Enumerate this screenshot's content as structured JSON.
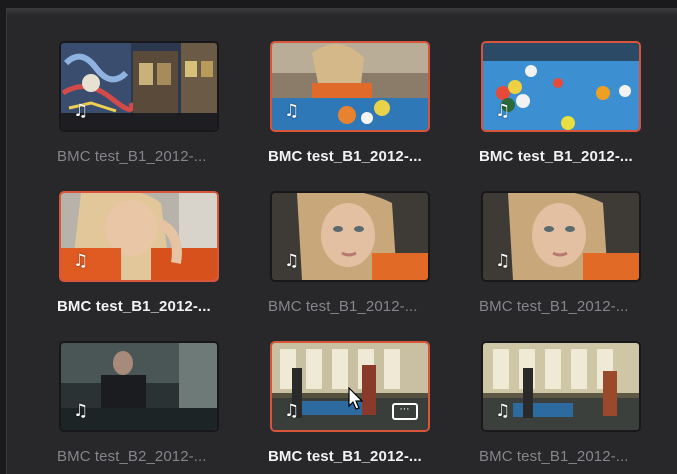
{
  "clips": [
    {
      "name": "BMC test_B1_2012-...",
      "scene": "graffiti",
      "selected": false,
      "has_audio": true
    },
    {
      "name": "BMC test_B1_2012-...",
      "scene": "pool-girl",
      "selected": true,
      "has_audio": true
    },
    {
      "name": "BMC test_B1_2012-...",
      "scene": "pool-table",
      "selected": true,
      "has_audio": true
    },
    {
      "name": "BMC test_B1_2012-...",
      "scene": "woman-hand",
      "selected": true,
      "has_audio": true
    },
    {
      "name": "BMC test_B1_2012-...",
      "scene": "woman-face",
      "selected": false,
      "has_audio": true
    },
    {
      "name": "BMC test_B1_2012-...",
      "scene": "woman-face",
      "selected": false,
      "has_audio": true
    },
    {
      "name": "BMC test_B2_2012-...",
      "scene": "man-room",
      "selected": false,
      "has_audio": true
    },
    {
      "name": "BMC test_B1_2012-...",
      "scene": "pool-hall",
      "selected": true,
      "has_audio": true,
      "hover": true,
      "more": "⋯"
    },
    {
      "name": "BMC test_B1_2012-...",
      "scene": "pool-hall2",
      "selected": false,
      "has_audio": true
    }
  ],
  "icons": {
    "audio": "music-note-icon",
    "more": "more-options-icon",
    "cursor": "mouse-pointer-icon"
  },
  "audio_glyph": "♫",
  "colors": {
    "selected_border": "#d8553c",
    "panel": "#28282b",
    "dim_text": "#85858a",
    "bright_text": "#f2f2f2"
  }
}
